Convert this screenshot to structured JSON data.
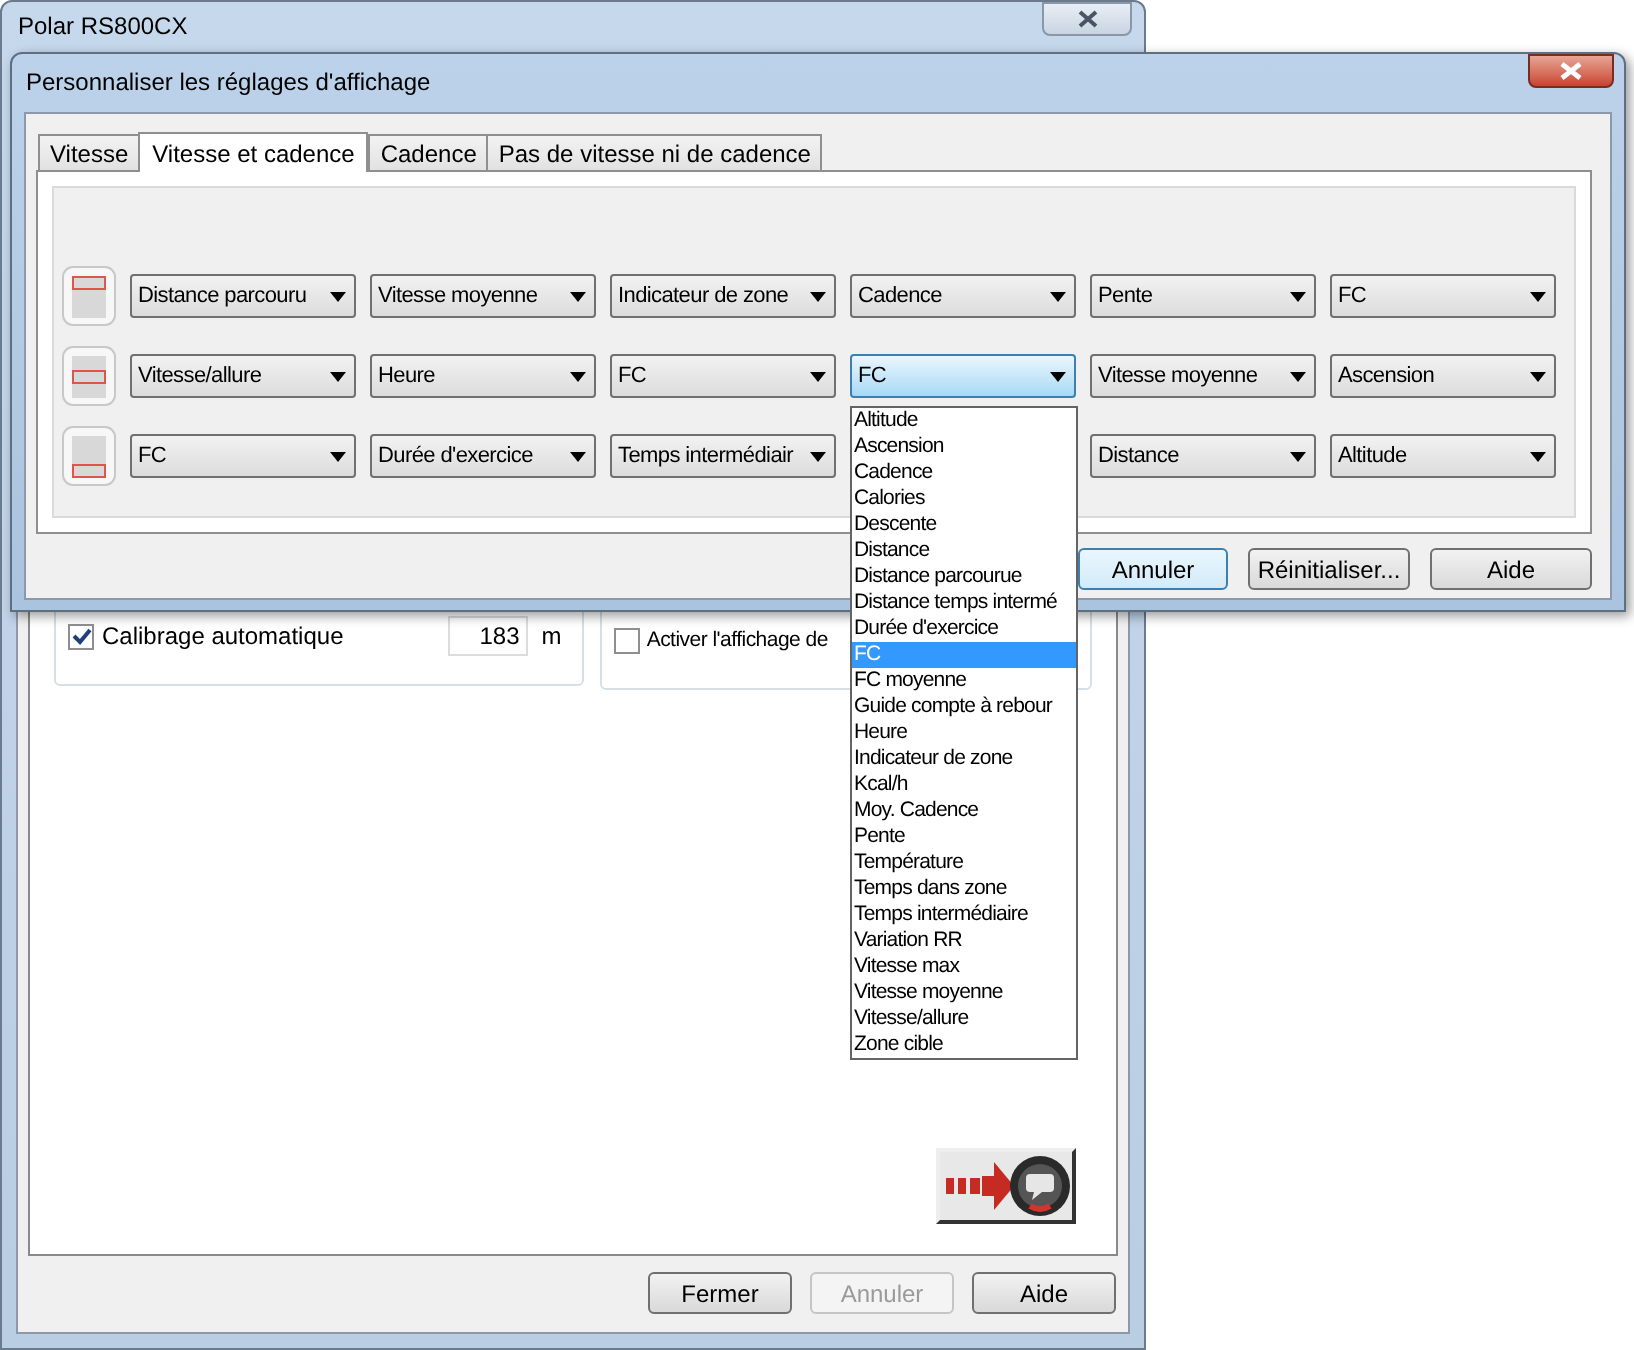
{
  "background_window": {
    "title": "Polar RS800CX",
    "calibration": {
      "label": "Calibrage automatique",
      "checked": true,
      "value": "183",
      "unit": "m"
    },
    "display_option": {
      "label": "Activer l'affichage de",
      "checked": false
    },
    "buttons": [
      {
        "label": "Fermer",
        "disabled": false
      },
      {
        "label": "Annuler",
        "disabled": true
      },
      {
        "label": "Aide",
        "disabled": false
      }
    ]
  },
  "dialog": {
    "title": "Personnaliser les réglages d'affichage",
    "tabs": [
      {
        "label": "Vitesse",
        "selected": false
      },
      {
        "label": "Vitesse et cadence",
        "selected": true
      },
      {
        "label": "Cadence",
        "selected": false
      },
      {
        "label": "Pas de vitesse ni de cadence",
        "selected": false
      }
    ],
    "rows": [
      {
        "kind": "top",
        "fields": [
          {
            "value": "Distance parcouru",
            "focused": false
          },
          {
            "value": "Vitesse moyenne",
            "focused": false
          },
          {
            "value": "Indicateur de zone",
            "focused": false
          },
          {
            "value": "Cadence",
            "focused": false
          },
          {
            "value": "Pente",
            "focused": false
          },
          {
            "value": "FC",
            "focused": false
          }
        ]
      },
      {
        "kind": "middle",
        "fields": [
          {
            "value": "Vitesse/allure",
            "focused": false
          },
          {
            "value": "Heure",
            "focused": false
          },
          {
            "value": "FC",
            "focused": false
          },
          {
            "value": "FC",
            "focused": true
          },
          {
            "value": "Vitesse moyenne",
            "focused": false
          },
          {
            "value": "Ascension",
            "focused": false
          }
        ]
      },
      {
        "kind": "bottom",
        "fields": [
          {
            "value": "FC",
            "focused": false
          },
          {
            "value": "Durée d'exercice",
            "focused": false
          },
          {
            "value": "Temps intermédiair",
            "focused": false
          },
          {
            "covered": true
          },
          {
            "value": "Distance",
            "focused": false
          },
          {
            "value": "Altitude",
            "focused": false
          }
        ]
      }
    ],
    "buttons": [
      {
        "label": "Annuler",
        "focused": true
      },
      {
        "label": "Réinitialiser...",
        "focused": false
      },
      {
        "label": "Aide",
        "focused": false
      }
    ],
    "dropdown_list": {
      "items": [
        {
          "label": "Altitude",
          "selected": false
        },
        {
          "label": "Ascension",
          "selected": false
        },
        {
          "label": "Cadence",
          "selected": false
        },
        {
          "label": "Calories",
          "selected": false
        },
        {
          "label": "Descente",
          "selected": false
        },
        {
          "label": "Distance",
          "selected": false
        },
        {
          "label": "Distance parcourue",
          "selected": false
        },
        {
          "label": "Distance temps intermé",
          "selected": false
        },
        {
          "label": "Durée d'exercice",
          "selected": false
        },
        {
          "label": "FC",
          "selected": true
        },
        {
          "label": "FC moyenne",
          "selected": false
        },
        {
          "label": "Guide compte à rebour",
          "selected": false
        },
        {
          "label": "Heure",
          "selected": false
        },
        {
          "label": "Indicateur de zone",
          "selected": false
        },
        {
          "label": "Kcal/h",
          "selected": false
        },
        {
          "label": "Moy. Cadence",
          "selected": false
        },
        {
          "label": "Pente",
          "selected": false
        },
        {
          "label": "Température",
          "selected": false
        },
        {
          "label": "Temps dans zone",
          "selected": false
        },
        {
          "label": "Temps intermédiaire",
          "selected": false
        },
        {
          "label": "Variation RR",
          "selected": false
        },
        {
          "label": "Vitesse max",
          "selected": false
        },
        {
          "label": "Vitesse moyenne",
          "selected": false
        },
        {
          "label": "Vitesse/allure",
          "selected": false
        },
        {
          "label": "Zone cible",
          "selected": false
        }
      ]
    }
  }
}
